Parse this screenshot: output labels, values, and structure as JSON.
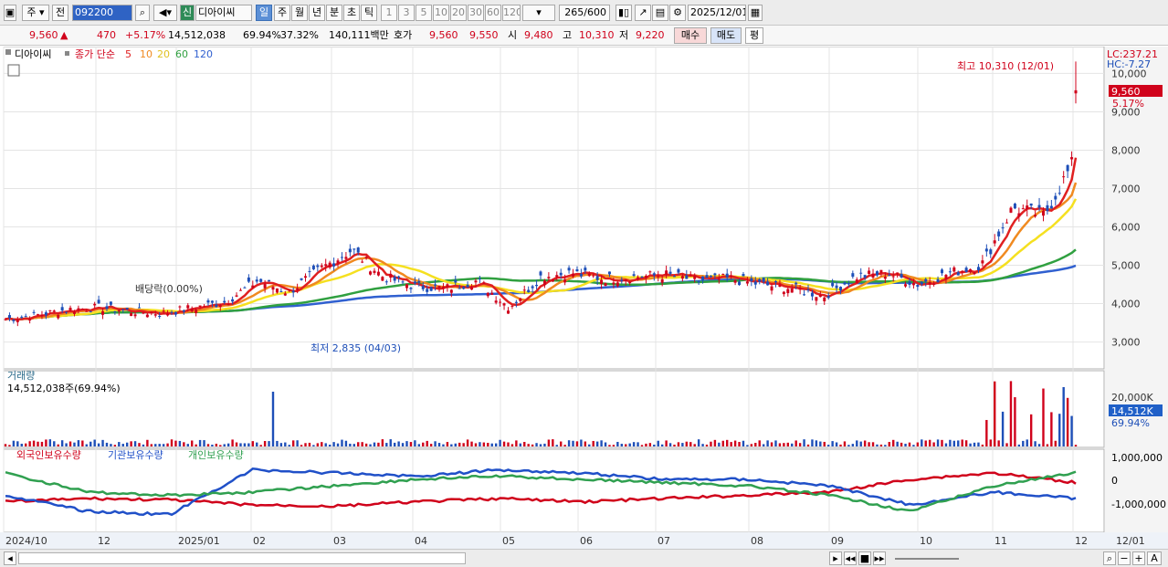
{
  "toolbar": {
    "market": "주",
    "prev": "전",
    "code": "092200",
    "new_label": "신",
    "name": "디아이씨",
    "periods": [
      "일",
      "주",
      "월",
      "년",
      "분",
      "초",
      "틱"
    ],
    "intervals": [
      "1",
      "3",
      "5",
      "10",
      "20",
      "30",
      "60",
      "120"
    ],
    "count": "265",
    "count_total": "/600",
    "date": "2025/12/01"
  },
  "quote": {
    "price": "9,560",
    "arrow": "▲",
    "change": "470",
    "rate": "+5.17%",
    "volume": "14,512,038",
    "vol_rate": "69.94%",
    "turnover": "37.32%",
    "amount": "140,111백만",
    "hoga_label": "호가",
    "ask": "9,560",
    "bid": "9,550",
    "open_label": "시",
    "open": "9,480",
    "high_label": "고",
    "high": "10,310",
    "low_label": "저",
    "low": "9,220",
    "buy": "매수",
    "sell": "매도",
    "avg": "평"
  },
  "chart_data": [
    {
      "type": "candlestick",
      "title": "디아이씨",
      "legend": [
        "종가 단순",
        "5",
        "10",
        "20",
        "60",
        "120"
      ],
      "x_labels": [
        "2024/10",
        "12",
        "2025/01",
        "02",
        "03",
        "04",
        "05",
        "06",
        "07",
        "08",
        "09",
        "10",
        "11",
        "12",
        "12/01"
      ],
      "y_ticks": [
        "3,000",
        "4,000",
        "5,000",
        "6,000",
        "7,000",
        "8,000",
        "9,000",
        "10,000"
      ],
      "ylim": [
        2300,
        10700
      ],
      "annotations": {
        "max": "최고 10,310 (12/01)",
        "min": "최저 2,835 (04/03)",
        "dividend": "배당락(0.00%)",
        "lc": "LC:237.21",
        "hc": "HC:-7.27",
        "cur": "9,560",
        "cur_rate": "5.17%"
      },
      "ma_colors": {
        "5": "#e02020",
        "10": "#f08a20",
        "20": "#f5e020",
        "60": "#30a040",
        "120": "#3060d0"
      },
      "ma_approx": {
        "5": [
          3600,
          3700,
          3850,
          3900,
          3800,
          3750,
          3900,
          4050,
          4600,
          4300,
          4900,
          5400,
          4700,
          4450,
          4400,
          4600,
          3900,
          4700,
          4800,
          4650,
          4700,
          4750,
          4600,
          4650,
          4500,
          4400,
          4200,
          4700,
          4800,
          4500,
          4800,
          5000,
          6500,
          6300,
          7800
        ]
      },
      "ohlc_anchor": {
        "open": 9480,
        "high": 10310,
        "low": 9220,
        "close": 9560
      }
    },
    {
      "type": "bar",
      "title": "거래량",
      "info": "14,512,038주(69.94%)",
      "y_ticks": [
        "20,000K"
      ],
      "cur": "14,512K",
      "cur_rate": "69.94%"
    },
    {
      "type": "line",
      "series": [
        {
          "name": "외국인보유수량",
          "color": "#d0021b"
        },
        {
          "name": "기관보유수량",
          "color": "#2050c8"
        },
        {
          "name": "개인보유수량",
          "color": "#30a050"
        }
      ],
      "y_ticks": [
        "1,000,000",
        "0",
        "-1,000,000"
      ]
    }
  ]
}
